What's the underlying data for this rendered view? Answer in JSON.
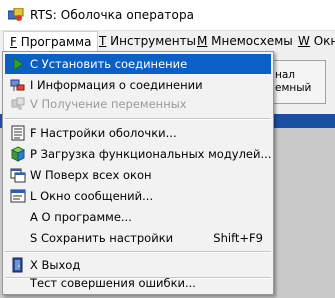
{
  "window": {
    "title": "RTS: Оболочка оператора"
  },
  "menubar": [
    {
      "label": "F Программа",
      "accel": "F"
    },
    {
      "label": "T Инструменты",
      "accel": "T"
    },
    {
      "label": "M Мнемосхемы",
      "accel": "M"
    },
    {
      "label": "W Окн",
      "accel": "W"
    }
  ],
  "background": {
    "button_line1": "нал",
    "button_line2": "емный"
  },
  "dropdown": {
    "items": [
      {
        "label": "C Установить соединение",
        "icon": "play-arrow-icon",
        "state": "highlighted"
      },
      {
        "label": "I Информация о соединении",
        "icon": "connection-info-icon",
        "state": "normal"
      },
      {
        "label": "V Получение переменных",
        "icon": "variables-icon",
        "state": "disabled"
      },
      {
        "label": "F Настройки оболочки...",
        "icon": "settings-list-icon",
        "state": "normal"
      },
      {
        "label": "P Загрузка функциональных модулей...",
        "icon": "module-cube-icon",
        "state": "normal"
      },
      {
        "label": "W Поверх всех окон",
        "icon": "windows-stack-icon",
        "state": "normal"
      },
      {
        "label": "L Окно сообщений...",
        "icon": "message-window-icon",
        "state": "normal"
      },
      {
        "label": "A О программе...",
        "icon": "",
        "state": "normal"
      },
      {
        "label": "S Сохранить настройки",
        "shortcut": "Shift+F9",
        "icon": "",
        "state": "normal"
      },
      {
        "label": "X Выход",
        "icon": "exit-door-icon",
        "state": "normal"
      },
      {
        "label": "Тест совершения ошибки...",
        "icon": "",
        "state": "normal"
      }
    ]
  },
  "colors": {
    "highlight": "#0a60c7",
    "disabled_text": "#9a9a9a",
    "menu_bg": "#f2f2f2"
  }
}
